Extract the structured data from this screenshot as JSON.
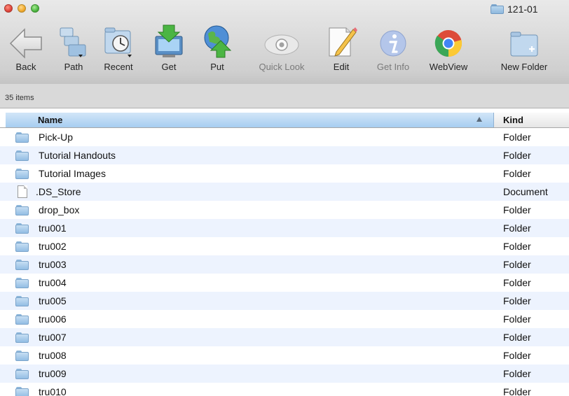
{
  "window": {
    "title": "121-01",
    "icon": "folder-icon"
  },
  "toolbar": {
    "items": [
      {
        "label": "Back",
        "icon": "back-arrow-icon",
        "enabled": true
      },
      {
        "label": "Path",
        "icon": "path-folders-icon",
        "enabled": true
      },
      {
        "label": "Recent",
        "icon": "recent-clock-folder-icon",
        "enabled": true
      },
      {
        "label": "Get",
        "icon": "get-download-icon",
        "enabled": true
      },
      {
        "label": "Put",
        "icon": "put-upload-globe-icon",
        "enabled": true
      },
      {
        "label": "Quick Look",
        "icon": "eye-icon",
        "enabled": false
      },
      {
        "label": "Edit",
        "icon": "edit-pencil-icon",
        "enabled": true
      },
      {
        "label": "Get Info",
        "icon": "info-icon",
        "enabled": false
      },
      {
        "label": "WebView",
        "icon": "chrome-icon",
        "enabled": true
      },
      {
        "label": "New Folder",
        "icon": "new-folder-icon",
        "enabled": true
      }
    ]
  },
  "status": {
    "item_count": "35 items"
  },
  "columns": {
    "name": "Name",
    "kind": "Kind",
    "sort": "ascending"
  },
  "files": [
    {
      "name": "Pick-Up",
      "kind": "Folder",
      "type": "folder"
    },
    {
      "name": "Tutorial Handouts",
      "kind": "Folder",
      "type": "folder"
    },
    {
      "name": "Tutorial Images",
      "kind": "Folder",
      "type": "folder"
    },
    {
      "name": ".DS_Store",
      "kind": "Document",
      "type": "document"
    },
    {
      "name": "drop_box",
      "kind": "Folder",
      "type": "folder"
    },
    {
      "name": "tru001",
      "kind": "Folder",
      "type": "folder"
    },
    {
      "name": "tru002",
      "kind": "Folder",
      "type": "folder"
    },
    {
      "name": "tru003",
      "kind": "Folder",
      "type": "folder"
    },
    {
      "name": "tru004",
      "kind": "Folder",
      "type": "folder"
    },
    {
      "name": "tru005",
      "kind": "Folder",
      "type": "folder"
    },
    {
      "name": "tru006",
      "kind": "Folder",
      "type": "folder"
    },
    {
      "name": "tru007",
      "kind": "Folder",
      "type": "folder"
    },
    {
      "name": "tru008",
      "kind": "Folder",
      "type": "folder"
    },
    {
      "name": "tru009",
      "kind": "Folder",
      "type": "folder"
    },
    {
      "name": "tru010",
      "kind": "Folder",
      "type": "folder"
    }
  ],
  "colors": {
    "header_selected": "#a7cdf0",
    "row_alt": "#edf3fe",
    "folder": "#93bde4"
  }
}
